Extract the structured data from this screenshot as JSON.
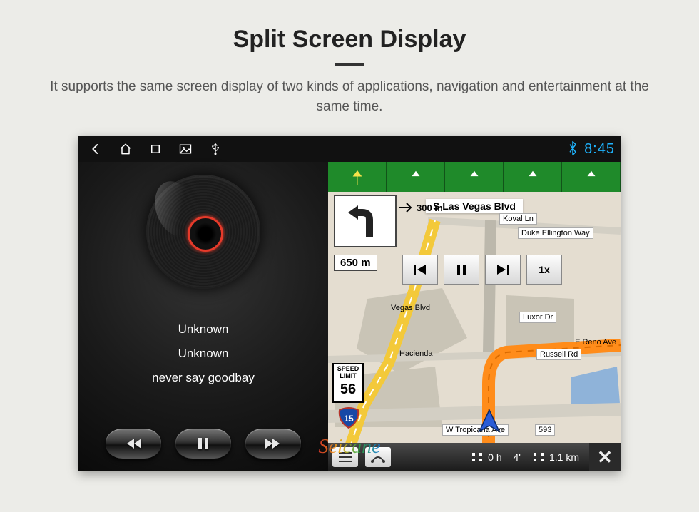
{
  "page": {
    "title": "Split Screen Display",
    "subtitle": "It supports the same screen display of two kinds of applications, navigation and entertainment at the same time."
  },
  "statusbar": {
    "time": "8:45"
  },
  "music": {
    "line1": "Unknown",
    "line2": "Unknown",
    "line3": "never say goodbay"
  },
  "nav": {
    "road_name": "S Las Vegas Blvd",
    "dist_preview": "300 m",
    "dist_main": "650 m",
    "speed_label_top": "SPEED",
    "speed_label_mid": "LIMIT",
    "speed_value": "56",
    "interstate": "15",
    "sim_speed": "1x",
    "streets": {
      "koval": "Koval Ln",
      "duke": "Duke Ellington Way",
      "luxor": "Luxor Dr",
      "hacienda": "Hacienda",
      "reno": "E Reno Ave",
      "russell": "Russell Rd",
      "trop": "W Tropicana Ave",
      "trop_no": "593",
      "vegas_blvd": "Vegas Blvd"
    },
    "bottom": {
      "eta_h": "0 h",
      "eta_m": "4'",
      "dist": "1.1 km"
    }
  },
  "watermark": "Seicane"
}
